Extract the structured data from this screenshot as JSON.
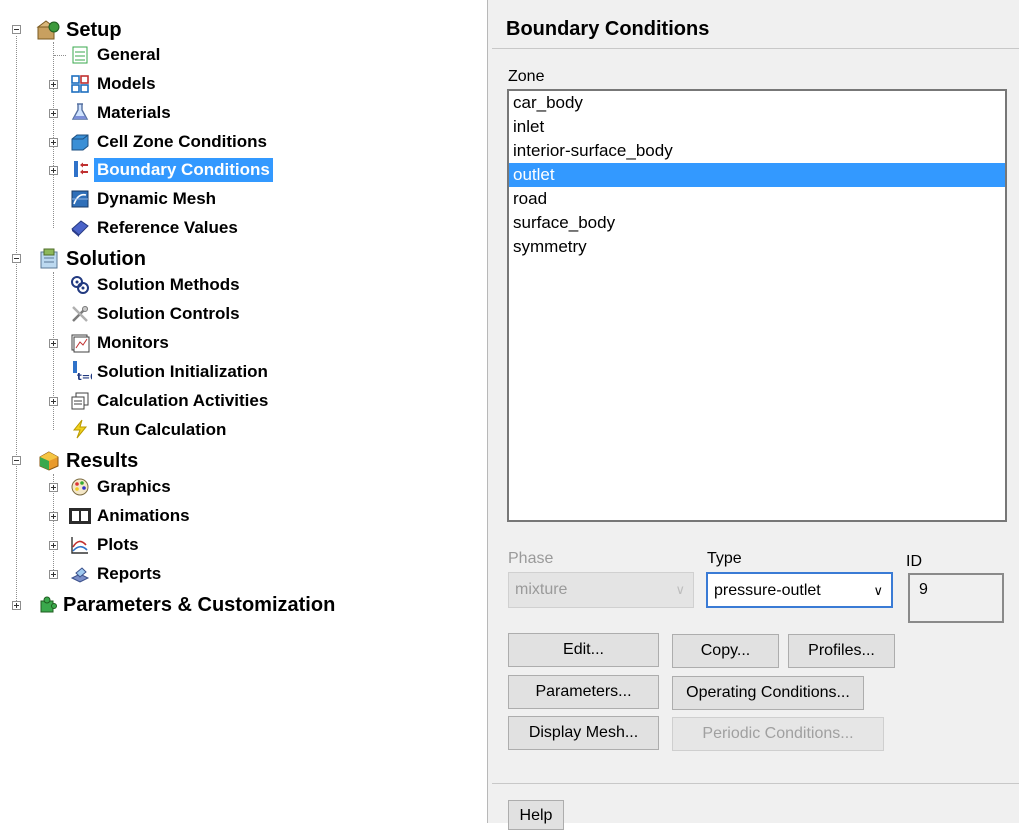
{
  "tree": {
    "setup": {
      "label": "Setup",
      "children": {
        "general": "General",
        "models": "Models",
        "materials": "Materials",
        "cell_zone_conditions": "Cell Zone Conditions",
        "boundary_conditions": "Boundary Conditions",
        "dynamic_mesh": "Dynamic Mesh",
        "reference_values": "Reference Values"
      }
    },
    "solution": {
      "label": "Solution",
      "children": {
        "solution_methods": "Solution Methods",
        "solution_controls": "Solution Controls",
        "monitors": "Monitors",
        "solution_initialization": "Solution Initialization",
        "calculation_activities": "Calculation Activities",
        "run_calculation": "Run Calculation"
      }
    },
    "results": {
      "label": "Results",
      "children": {
        "graphics": "Graphics",
        "animations": "Animations",
        "plots": "Plots",
        "reports": "Reports"
      }
    },
    "parameters": {
      "label": "Parameters & Customization"
    },
    "icons": {
      "setup": "setup-icon",
      "general": "general-icon",
      "models": "models-icon",
      "materials": "flask-icon",
      "cell_zone_conditions": "cell-zone-icon",
      "boundary_conditions": "boundary-icon",
      "dynamic_mesh": "dynamic-mesh-icon",
      "reference_values": "reference-values-icon",
      "solution": "solution-icon",
      "solution_methods": "methods-icon",
      "solution_controls": "controls-icon",
      "monitors": "monitors-icon",
      "solution_initialization": "initialization-icon",
      "calculation_activities": "activities-icon",
      "run_calculation": "lightning-icon",
      "results": "results-icon",
      "graphics": "palette-icon",
      "animations": "film-icon",
      "plots": "plot-icon",
      "reports": "reports-icon",
      "parameters": "puzzle-icon"
    },
    "selected": "boundary_conditions"
  },
  "panel": {
    "title": "Boundary Conditions",
    "zone_label": "Zone",
    "zones": [
      "car_body",
      "inlet",
      "interior-surface_body",
      "outlet",
      "road",
      "surface_body",
      "symmetry"
    ],
    "selected_zone": "outlet",
    "phase_label": "Phase",
    "phase_value": "mixture",
    "type_label": "Type",
    "type_value": "pressure-outlet",
    "id_label": "ID",
    "id_value": "9",
    "buttons": {
      "edit": "Edit...",
      "copy": "Copy...",
      "profiles": "Profiles...",
      "parameters": "Parameters...",
      "operating_conditions": "Operating Conditions...",
      "display_mesh": "Display Mesh...",
      "periodic_conditions": "Periodic Conditions...",
      "help": "Help"
    }
  },
  "colors": {
    "selection": "#3399ff",
    "panel_bg": "#f0f0f0",
    "button_bg": "#e1e1e1"
  }
}
